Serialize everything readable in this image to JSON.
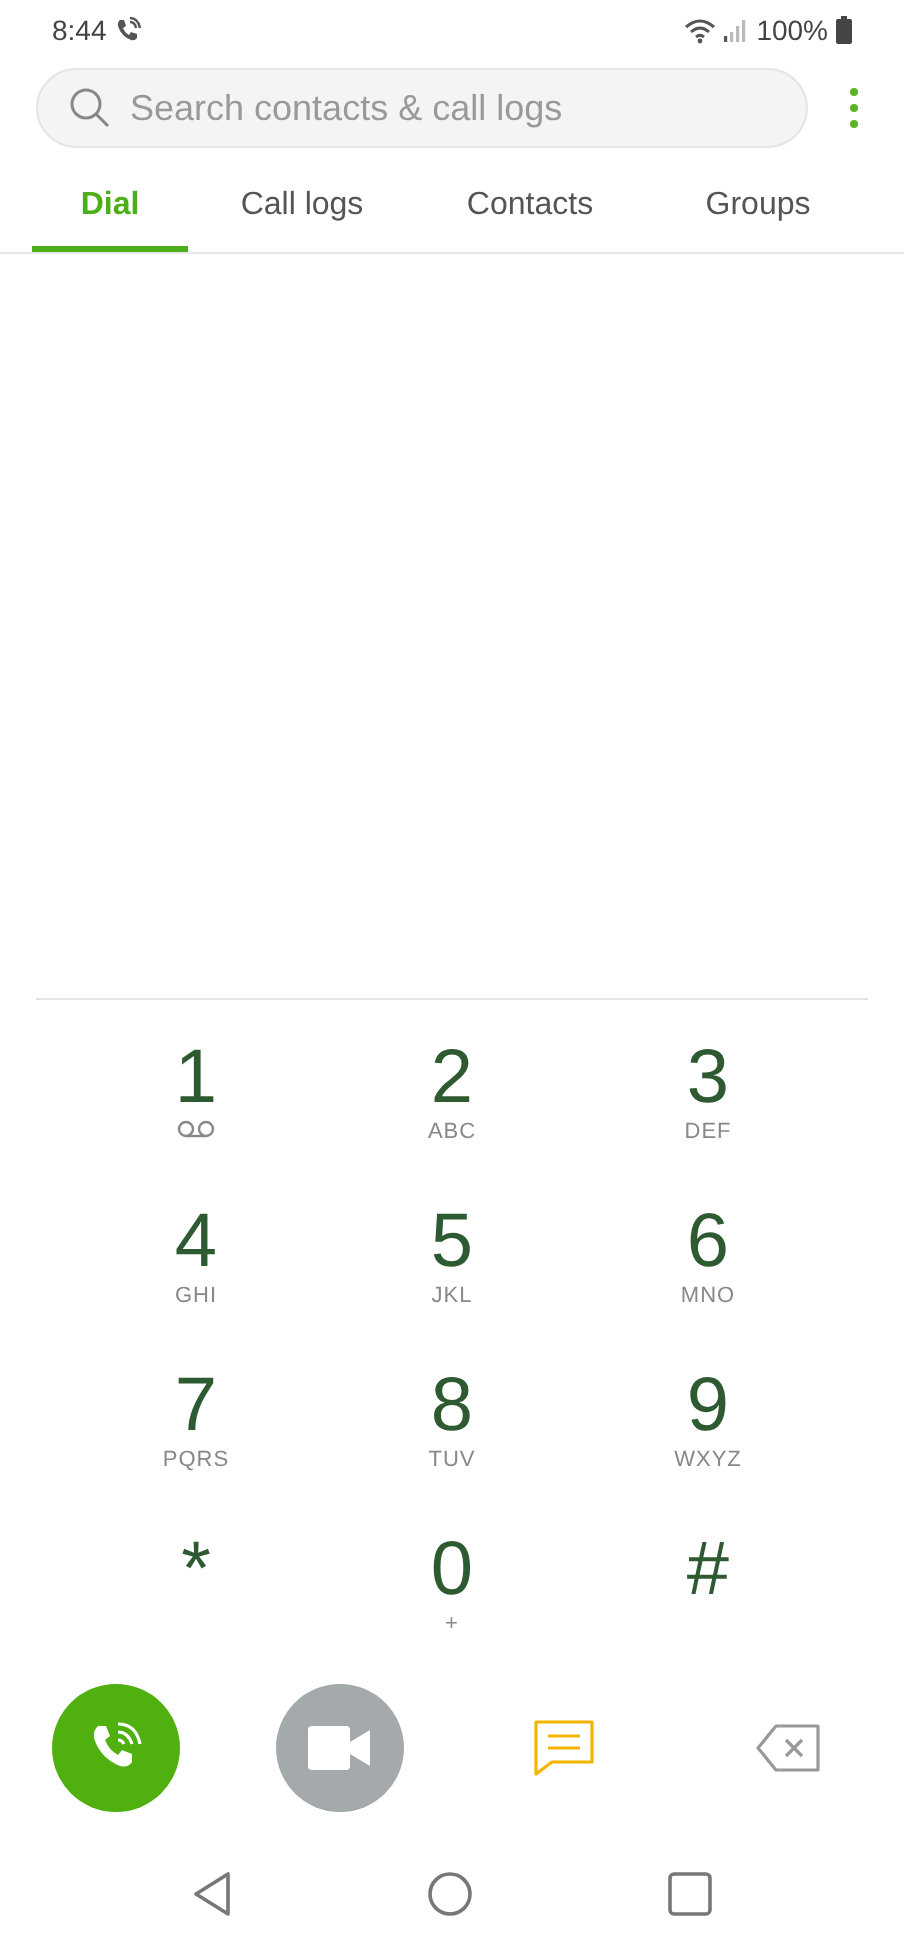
{
  "status_bar": {
    "time": "8:44",
    "battery": "100%"
  },
  "search": {
    "placeholder": "Search contacts & call logs"
  },
  "tabs": [
    {
      "label": "Dial",
      "selected": true
    },
    {
      "label": "Call logs",
      "selected": false
    },
    {
      "label": "Contacts",
      "selected": false
    },
    {
      "label": "Groups",
      "selected": false
    }
  ],
  "keypad": [
    {
      "digit": "1",
      "kind": "voicemail"
    },
    {
      "digit": "2",
      "kind": "text",
      "sub": "ABC"
    },
    {
      "digit": "3",
      "kind": "text",
      "sub": "DEF"
    },
    {
      "digit": "4",
      "kind": "text",
      "sub": "GHI"
    },
    {
      "digit": "5",
      "kind": "text",
      "sub": "JKL"
    },
    {
      "digit": "6",
      "kind": "text",
      "sub": "MNO"
    },
    {
      "digit": "7",
      "kind": "text",
      "sub": "PQRS"
    },
    {
      "digit": "8",
      "kind": "text",
      "sub": "TUV"
    },
    {
      "digit": "9",
      "kind": "text",
      "sub": "WXYZ"
    },
    {
      "digit": "*",
      "kind": "plain"
    },
    {
      "digit": "0",
      "kind": "text",
      "sub": "+"
    },
    {
      "digit": "#",
      "kind": "plain"
    }
  ]
}
